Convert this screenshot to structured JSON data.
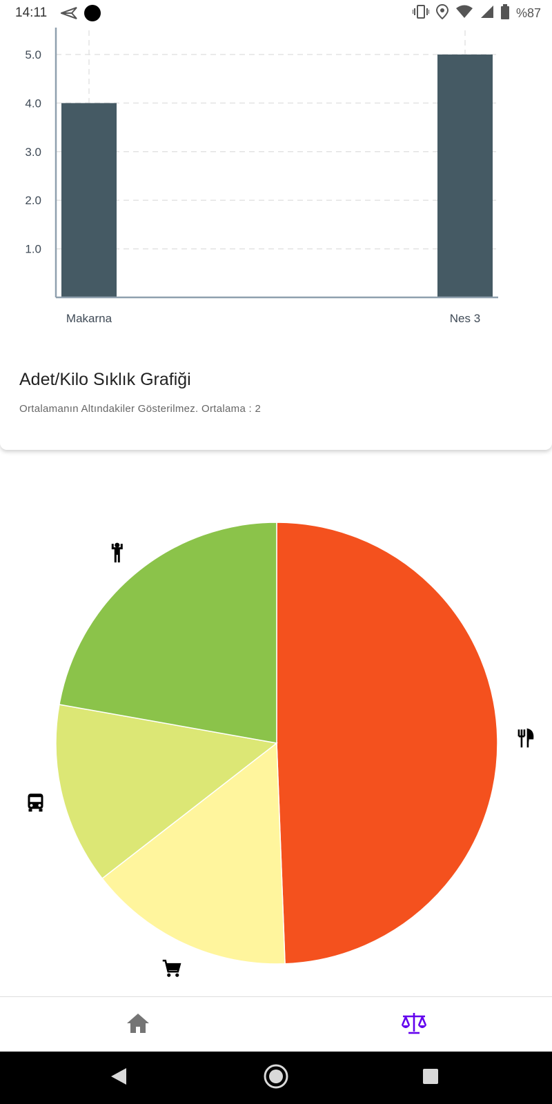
{
  "status_bar": {
    "time": "14:11",
    "battery_percent": "%87",
    "icons": [
      "send-icon",
      "circle-icon",
      "vibrate-icon",
      "location-icon",
      "wifi-icon",
      "signal-icon",
      "battery-icon"
    ]
  },
  "frequency_card": {
    "title": "Adet/Kilo Sıklık Grafiği",
    "subtitle": "Ortalamanın Altındakiler Gösterilmez. Ortalama : 2"
  },
  "chart_data": [
    {
      "type": "bar",
      "categories": [
        "Makarna",
        "Nes 3"
      ],
      "values": [
        4,
        5
      ],
      "y_ticks": [
        "1.0",
        "2.0",
        "3.0",
        "4.0",
        "5.0"
      ],
      "ylim": [
        0,
        5
      ],
      "grid": true,
      "color": "#455a64"
    },
    {
      "type": "pie",
      "slices": [
        {
          "icon": "restaurant-icon",
          "value": 49.4,
          "color": "#f4511e"
        },
        {
          "icon": "cart-icon",
          "value": 15.1,
          "color": "#fff59d"
        },
        {
          "icon": "bus-icon",
          "value": 13.3,
          "color": "#dce775"
        },
        {
          "icon": "person-icon",
          "value": 22.2,
          "color": "#8bc34a"
        }
      ]
    }
  ],
  "bottom_nav": {
    "items": [
      {
        "icon": "home-icon",
        "active": false,
        "color": "#757575"
      },
      {
        "icon": "scale-icon",
        "active": true,
        "color": "#6200ee"
      }
    ]
  },
  "system_nav": {
    "items": [
      "back-icon",
      "home-circle-icon",
      "recents-icon"
    ]
  }
}
